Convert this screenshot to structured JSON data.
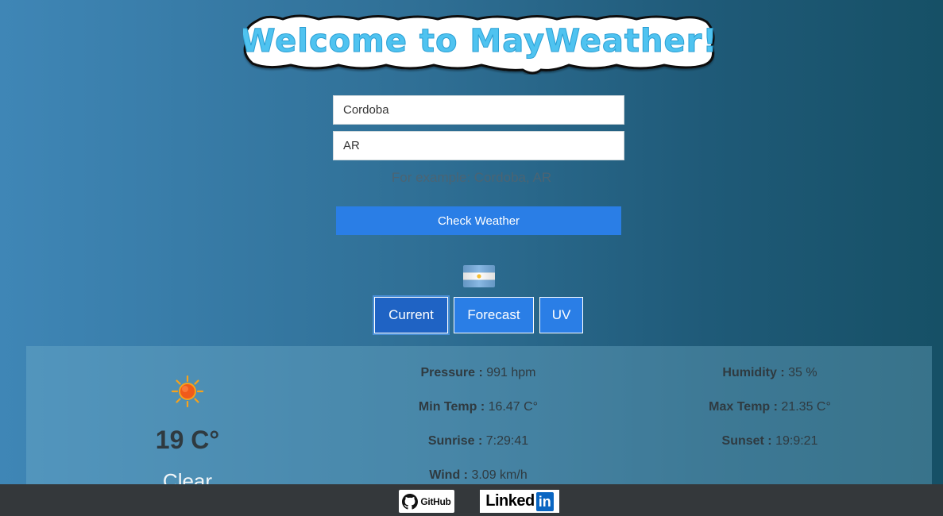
{
  "header": {
    "title": "Welcome to MayWeather!"
  },
  "form": {
    "city_value": "Cordoba",
    "country_value": "AR",
    "hint": "For example: Cordoba, AR",
    "submit_label": "Check Weather"
  },
  "flag": {
    "icon": "argentina-flag-icon",
    "colors": [
      "#74acdf",
      "#ffffff",
      "#f6b40e"
    ]
  },
  "tabs": [
    {
      "label": "Current",
      "active": true
    },
    {
      "label": "Forecast",
      "active": false
    },
    {
      "label": "UV",
      "active": false
    }
  ],
  "current": {
    "icon": "sun-icon",
    "temperature": "19 C°",
    "description": "Clear",
    "stats": [
      {
        "label": "Pressure :",
        "value": "991 hpm"
      },
      {
        "label": "Humidity :",
        "value": "35 %"
      },
      {
        "label": "Min Temp :",
        "value": "16.47 C°"
      },
      {
        "label": "Max Temp :",
        "value": "21.35 C°"
      },
      {
        "label": "Sunrise :",
        "value": "7:29:41"
      },
      {
        "label": "Sunset :",
        "value": "19:9:21"
      },
      {
        "label": "Wind :",
        "value": "3.09 km/h"
      }
    ]
  },
  "footer": {
    "github_label": "GitHub",
    "linkedin_label": "Linked",
    "linkedin_box": "in"
  },
  "colors": {
    "accent": "#2a7ee6",
    "active_tab": "#1f63c4",
    "title_fill": "#4fc3f0",
    "footer_bg": "#34383b"
  }
}
